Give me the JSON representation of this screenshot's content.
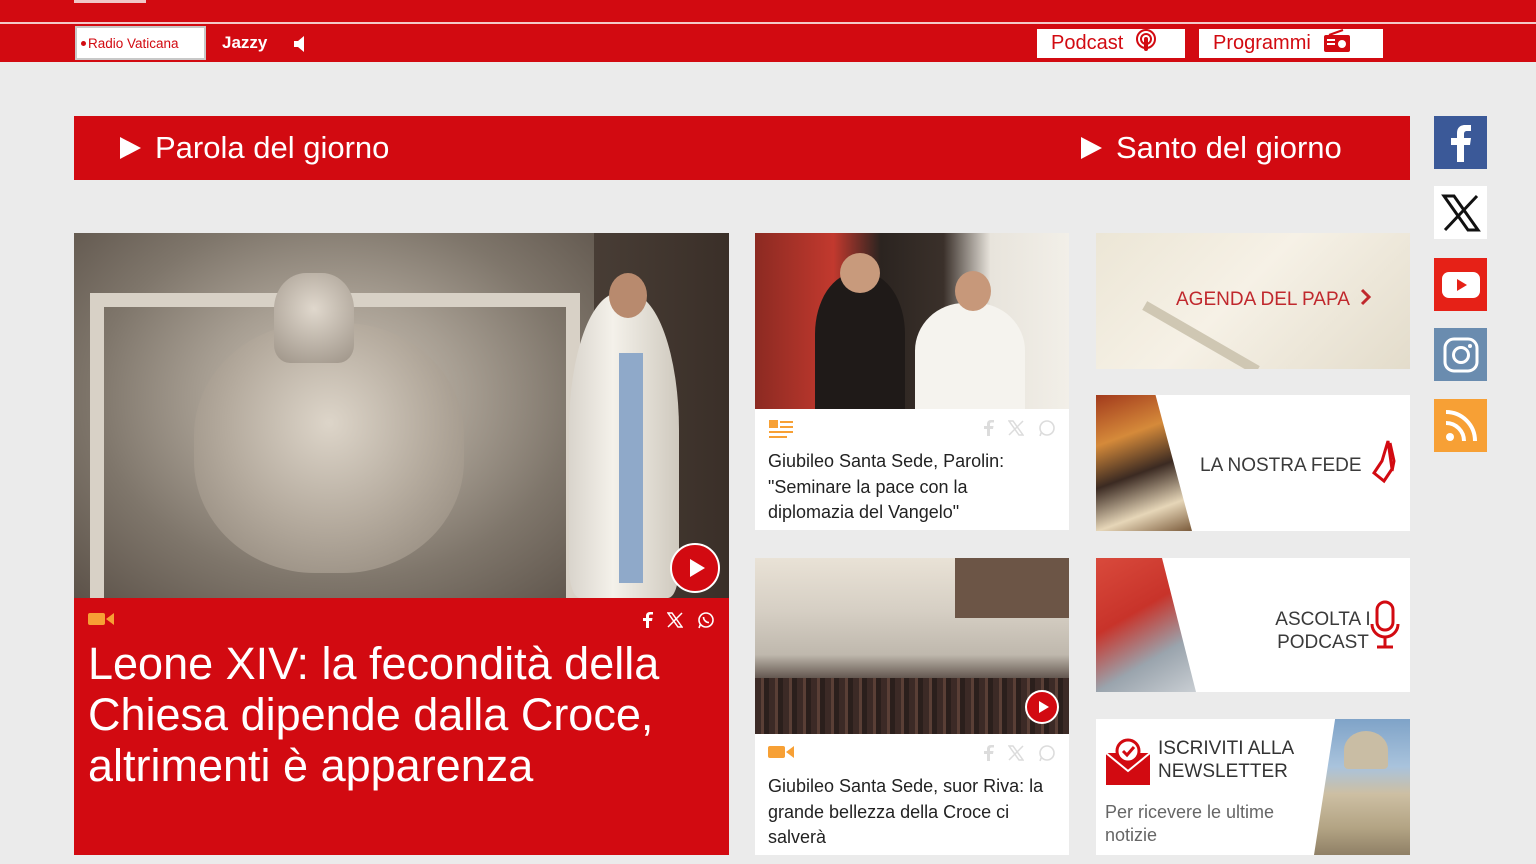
{
  "header": {
    "radio_label": "Radio Vaticana",
    "channel": "Jazzy",
    "podcast_label": "Podcast",
    "programmi_label": "Programmi"
  },
  "daybar": {
    "parola": "Parola del giorno",
    "santo": "Santo del giorno"
  },
  "social": [
    "facebook-icon",
    "x-icon",
    "youtube-icon",
    "instagram-icon",
    "rss-icon"
  ],
  "hero": {
    "title": "Leone XIV: la fecondità della Chiesa dipende dalla Croce, altrimenti è apparenza"
  },
  "cards": [
    {
      "title": "Giubileo Santa Sede, Parolin: \"Seminare la pace con la diplomazia del Vangelo\"",
      "type_icon": "article-icon"
    },
    {
      "title": "Giubileo Santa Sede, suor Riva: la grande bellezza della Croce ci salverà",
      "type_icon": "video-icon"
    }
  ],
  "tiles": {
    "agenda": "AGENDA DEL PAPA",
    "fede": "LA NOSTRA FEDE",
    "podcast": "ASCOLTA I PODCAST",
    "newsletter_title": "ISCRIVITI ALLA NEWSLETTER",
    "newsletter_sub": "Per ricevere le ultime notizie"
  },
  "colors": {
    "brand_red": "#d20a11",
    "video_icon": "#f7a035"
  }
}
